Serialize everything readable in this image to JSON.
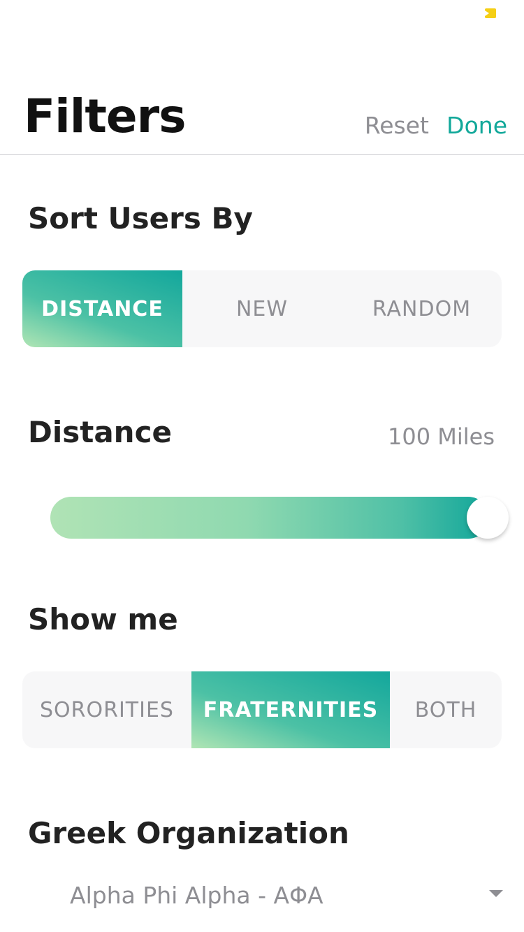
{
  "header": {
    "title": "Filters",
    "reset_label": "Reset",
    "done_label": "Done"
  },
  "sort": {
    "title": "Sort Users By",
    "options": [
      "DISTANCE",
      "NEW",
      "RANDOM"
    ],
    "selected": "DISTANCE"
  },
  "distance": {
    "title": "Distance",
    "value_label": "100 Miles",
    "slider_fraction": 1.0
  },
  "show_me": {
    "title": "Show me",
    "options": [
      "SORORITIES",
      "FRATERNITIES",
      "BOTH"
    ],
    "selected": "FRATERNITIES"
  },
  "organization": {
    "title": "Greek Organization",
    "selected_value": "Alpha Phi Alpha - ΑΦΑ"
  },
  "colors": {
    "accent": "#12a89a",
    "accent_light": "#b0e3b5",
    "muted_text": "#8e8e93",
    "status_battery": "#f5cf16"
  }
}
